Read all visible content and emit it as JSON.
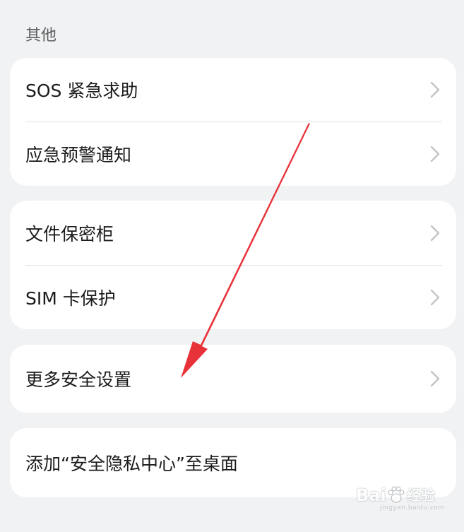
{
  "section": {
    "title": "其他"
  },
  "groups": [
    {
      "items": [
        {
          "label": "SOS 紧急求助"
        },
        {
          "label": "应急预警通知"
        }
      ]
    },
    {
      "items": [
        {
          "label": "文件保密柜"
        },
        {
          "label": "SIM 卡保护"
        }
      ]
    },
    {
      "items": [
        {
          "label": "更多安全设置"
        }
      ]
    },
    {
      "items": [
        {
          "label": "添加“安全隐私中心”至桌面"
        }
      ]
    }
  ],
  "watermark": {
    "brand_left": "Bai",
    "brand_right": "经验",
    "url": "jingyan.baidu.com"
  },
  "colors": {
    "background": "#f1f2f4",
    "card": "#ffffff",
    "arrow": "#e8323a",
    "chevron": "#c4c4c4"
  }
}
